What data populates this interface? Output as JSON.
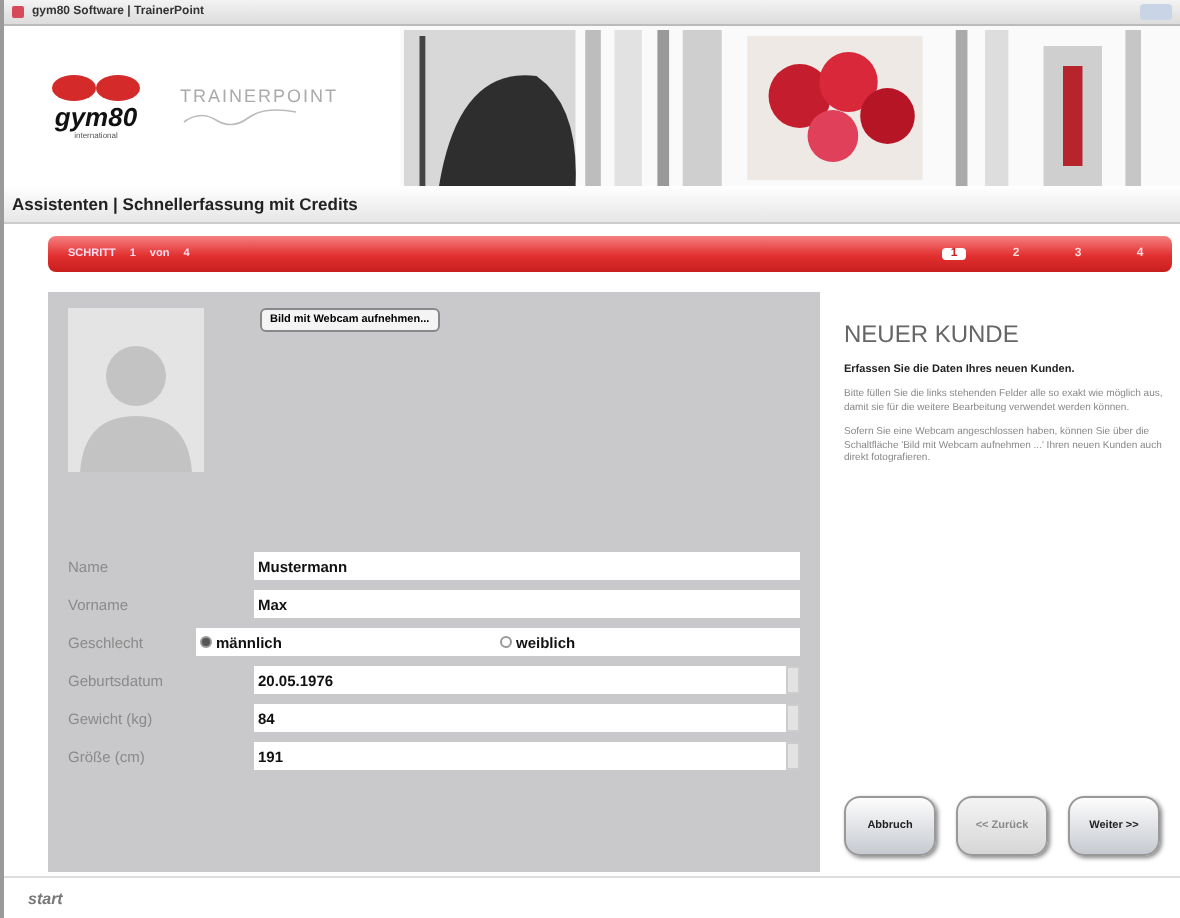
{
  "window": {
    "title": "gym80 Software | TrainerPoint"
  },
  "header": {
    "logo": "gym80",
    "logo_sub": "international",
    "product": "TRAINERPOINT"
  },
  "section_title": "Assistenten | Schnellerfassung mit Credits",
  "steps": {
    "label": "SCHRITT",
    "current": "1",
    "of": "von",
    "total": "4",
    "items": [
      {
        "label": "1",
        "selected": true
      },
      {
        "label": "2",
        "selected": false
      },
      {
        "label": "3",
        "selected": false
      },
      {
        "label": "4",
        "selected": false
      }
    ]
  },
  "webcam_button": "Bild mit Webcam aufnehmen...",
  "fields": [
    {
      "kind": "text",
      "label": "Name",
      "value": "Mustermann"
    },
    {
      "kind": "text",
      "label": "Vorname",
      "value": "Max"
    },
    {
      "kind": "radio",
      "label": "Geschlecht",
      "options": [
        {
          "label": "männlich",
          "selected": true
        },
        {
          "label": "weiblich",
          "selected": false
        }
      ]
    },
    {
      "kind": "spin",
      "label": "Geburtsdatum",
      "value": "20.05.1976"
    },
    {
      "kind": "spin",
      "label": "Gewicht (kg)",
      "value": "84"
    },
    {
      "kind": "spin",
      "label": "Größe (cm)",
      "value": "191"
    }
  ],
  "info": {
    "heading": "NEUER KUNDE",
    "lead": "Erfassen Sie die Daten Ihres neuen Kunden.",
    "paragraphs": [
      "Bitte füllen Sie die links stehenden Felder alle so exakt wie möglich aus, damit sie für die weitere Bearbeitung verwendet werden können.",
      "Sofern Sie eine Webcam angeschlossen haben, können Sie über die Schaltfläche 'Bild mit Webcam aufnehmen ...' Ihren neuen Kunden auch direkt fotografieren."
    ]
  },
  "buttons": [
    {
      "label": "Abbruch",
      "disabled": false
    },
    {
      "label": "<< Zurück",
      "disabled": true
    },
    {
      "label": "Weiter >>",
      "disabled": false
    }
  ],
  "footer": {
    "start": "start"
  }
}
